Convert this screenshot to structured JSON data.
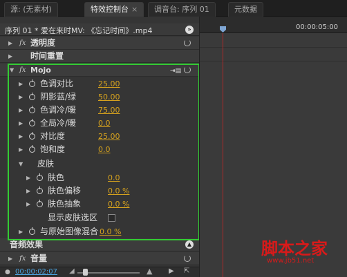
{
  "tabs": [
    {
      "label": "源: (无素材)",
      "active": false
    },
    {
      "label": "特效控制台",
      "active": true,
      "close": "×"
    },
    {
      "label": "调音台: 序列 01",
      "active": false
    },
    {
      "label": "元数据",
      "active": false
    }
  ],
  "header": {
    "title": "序列 01 * 爱在来时MV: 《忘记时间》.mp4"
  },
  "effects": {
    "opacity": "透明度",
    "time_remap": "时间重置",
    "mojo": "Mojo",
    "params": [
      {
        "label": "色调对比",
        "value": "25.00"
      },
      {
        "label": "阴影蓝/绿",
        "value": "50.00"
      },
      {
        "label": "色调冷/暖",
        "value": "75.00"
      },
      {
        "label": "全局冷/暖",
        "value": "0.0"
      },
      {
        "label": "对比度",
        "value": "25.00"
      },
      {
        "label": "饱和度",
        "value": "0.0"
      }
    ],
    "skin": "皮肤",
    "skin_params": [
      {
        "label": "肤色",
        "value": "0.0"
      },
      {
        "label": "肤色偏移",
        "value": "0.0 %"
      },
      {
        "label": "肤色抽象",
        "value": "0.0 %"
      }
    ],
    "show_skin": "显示皮肤选区",
    "blend": {
      "label": "与原始图像混合",
      "value": "0.0 %"
    },
    "audio": "音频效果",
    "volume": "音量"
  },
  "bottom": {
    "timecode": "00:00:02:07"
  },
  "timeline": {
    "timecode": "00:00:05:00"
  },
  "watermark": {
    "line1": "脚本之家",
    "line2": "www.jb51.net"
  },
  "colors": {
    "accent": "#d6a21e",
    "highlight": "#33cc33",
    "timecode": "#4aa3df"
  }
}
